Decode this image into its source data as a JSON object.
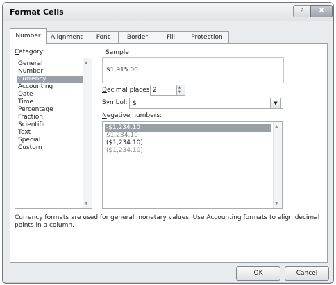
{
  "window": {
    "title": "Format Cells"
  },
  "titlebar": {
    "help_label": "?",
    "close_label": "X"
  },
  "tabs": [
    {
      "label": "Number",
      "active": true
    },
    {
      "label": "Alignment"
    },
    {
      "label": "Font"
    },
    {
      "label": "Border"
    },
    {
      "label": "Fill"
    },
    {
      "label": "Protection"
    }
  ],
  "category": {
    "label": "Category:",
    "items": [
      "General",
      "Number",
      "Currency",
      "Accounting",
      "Date",
      "Time",
      "Percentage",
      "Fraction",
      "Scientific",
      "Text",
      "Special",
      "Custom"
    ],
    "selected": "Currency"
  },
  "sample": {
    "label": "Sample",
    "value": "$1,915.00"
  },
  "decimal_places": {
    "label": "Decimal places:",
    "value": "2"
  },
  "symbol": {
    "label": "Symbol:",
    "value": "$"
  },
  "negative_numbers": {
    "label": "Negative numbers:",
    "items": [
      {
        "text": "-$1,234.10",
        "color": "#ffffff",
        "selected": true
      },
      {
        "text": "$1,234.10",
        "color": "#8a8a8a"
      },
      {
        "text": "($1,234.10)",
        "color": "#222222"
      },
      {
        "text": "($1,234.10)",
        "color": "#8a8a8a"
      }
    ]
  },
  "description": "Currency formats are used for general monetary values.  Use Accounting formats to align decimal points in a column.",
  "buttons": {
    "ok": "OK",
    "cancel": "Cancel"
  },
  "colors": {
    "selection": "#9ba0a6",
    "dialog_bg": "#e9ecee",
    "panel_bg": "#ffffff"
  }
}
